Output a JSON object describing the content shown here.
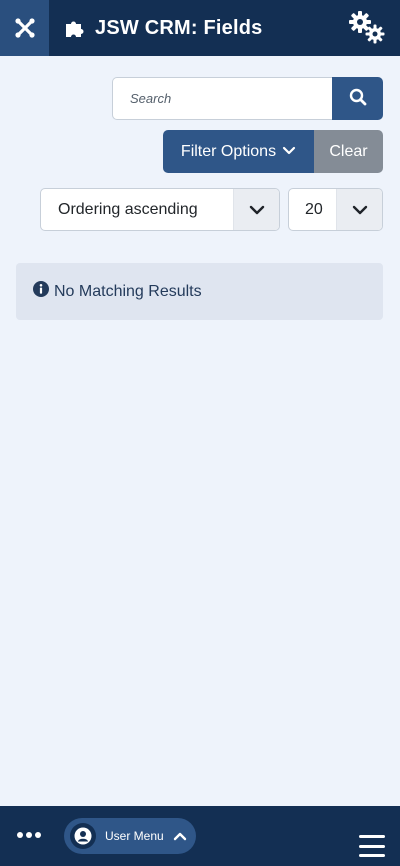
{
  "header": {
    "title": "JSW CRM: Fields",
    "logo_icon": "joomla-logo-icon",
    "title_icon": "puzzle-piece-icon",
    "options_icon": "gears-icon"
  },
  "search": {
    "placeholder": "Search",
    "button_icon": "search-icon"
  },
  "filter": {
    "filter_label": "Filter Options",
    "clear_label": "Clear"
  },
  "list_controls": {
    "ordering_value": "Ordering ascending",
    "limit_value": "20"
  },
  "alert": {
    "icon": "info-circle-icon",
    "message": "No Matching Results"
  },
  "bottom_bar": {
    "more_icon": "ellipsis-icon",
    "user_menu_label": "User Menu",
    "menu_icon": "hamburger-icon"
  },
  "colors": {
    "header_bg": "#132f53",
    "accent": "#2f5688",
    "page_bg": "#eef3fb",
    "clear_bg": "#848c96",
    "alert_bg": "#dfe5f0"
  }
}
